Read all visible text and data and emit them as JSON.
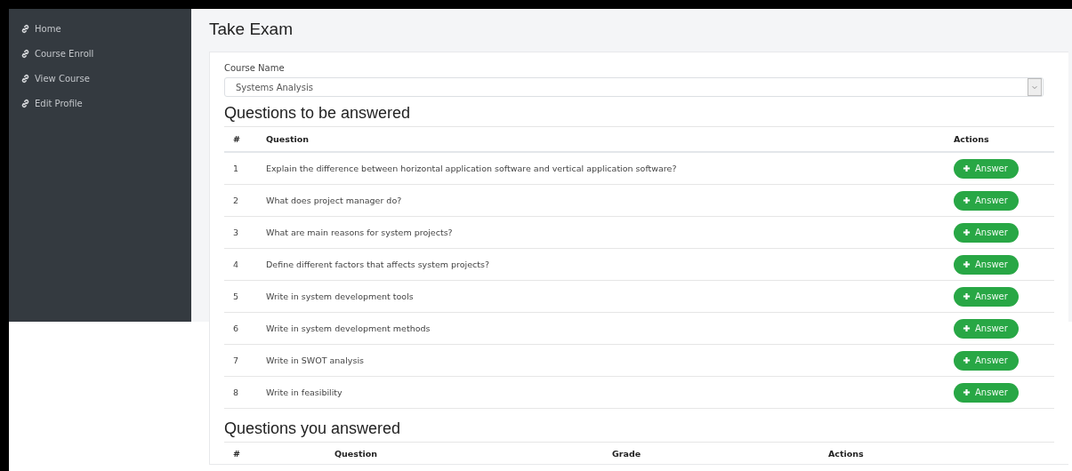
{
  "sidebar": {
    "items": [
      {
        "label": "Home"
      },
      {
        "label": "Course Enroll"
      },
      {
        "label": "View Course"
      },
      {
        "label": "Edit Profile"
      }
    ]
  },
  "page_title": "Take Exam",
  "course_field": {
    "label": "Course Name",
    "value": "Systems Analysis"
  },
  "pending": {
    "title": "Questions to be answered",
    "columns": [
      "#",
      "Question",
      "Actions"
    ],
    "rows": [
      {
        "number": "1",
        "question": "Explain the difference between horizontal application software and vertical application software?",
        "action": "Answer"
      },
      {
        "number": "2",
        "question": "What does project manager do?",
        "action": "Answer"
      },
      {
        "number": "3",
        "question": "What are main reasons for system projects?",
        "action": "Answer"
      },
      {
        "number": "4",
        "question": "Define different factors that affects system projects?",
        "action": "Answer"
      },
      {
        "number": "5",
        "question": "Write in system development tools",
        "action": "Answer"
      },
      {
        "number": "6",
        "question": "Write in system development methods",
        "action": "Answer"
      },
      {
        "number": "7",
        "question": "Write in SWOT analysis",
        "action": "Answer"
      },
      {
        "number": "8",
        "question": "Write in feasibility",
        "action": "Answer"
      }
    ]
  },
  "answered": {
    "title": "Questions you answered",
    "columns": [
      "#",
      "Question",
      "Grade",
      "Actions"
    ]
  }
}
